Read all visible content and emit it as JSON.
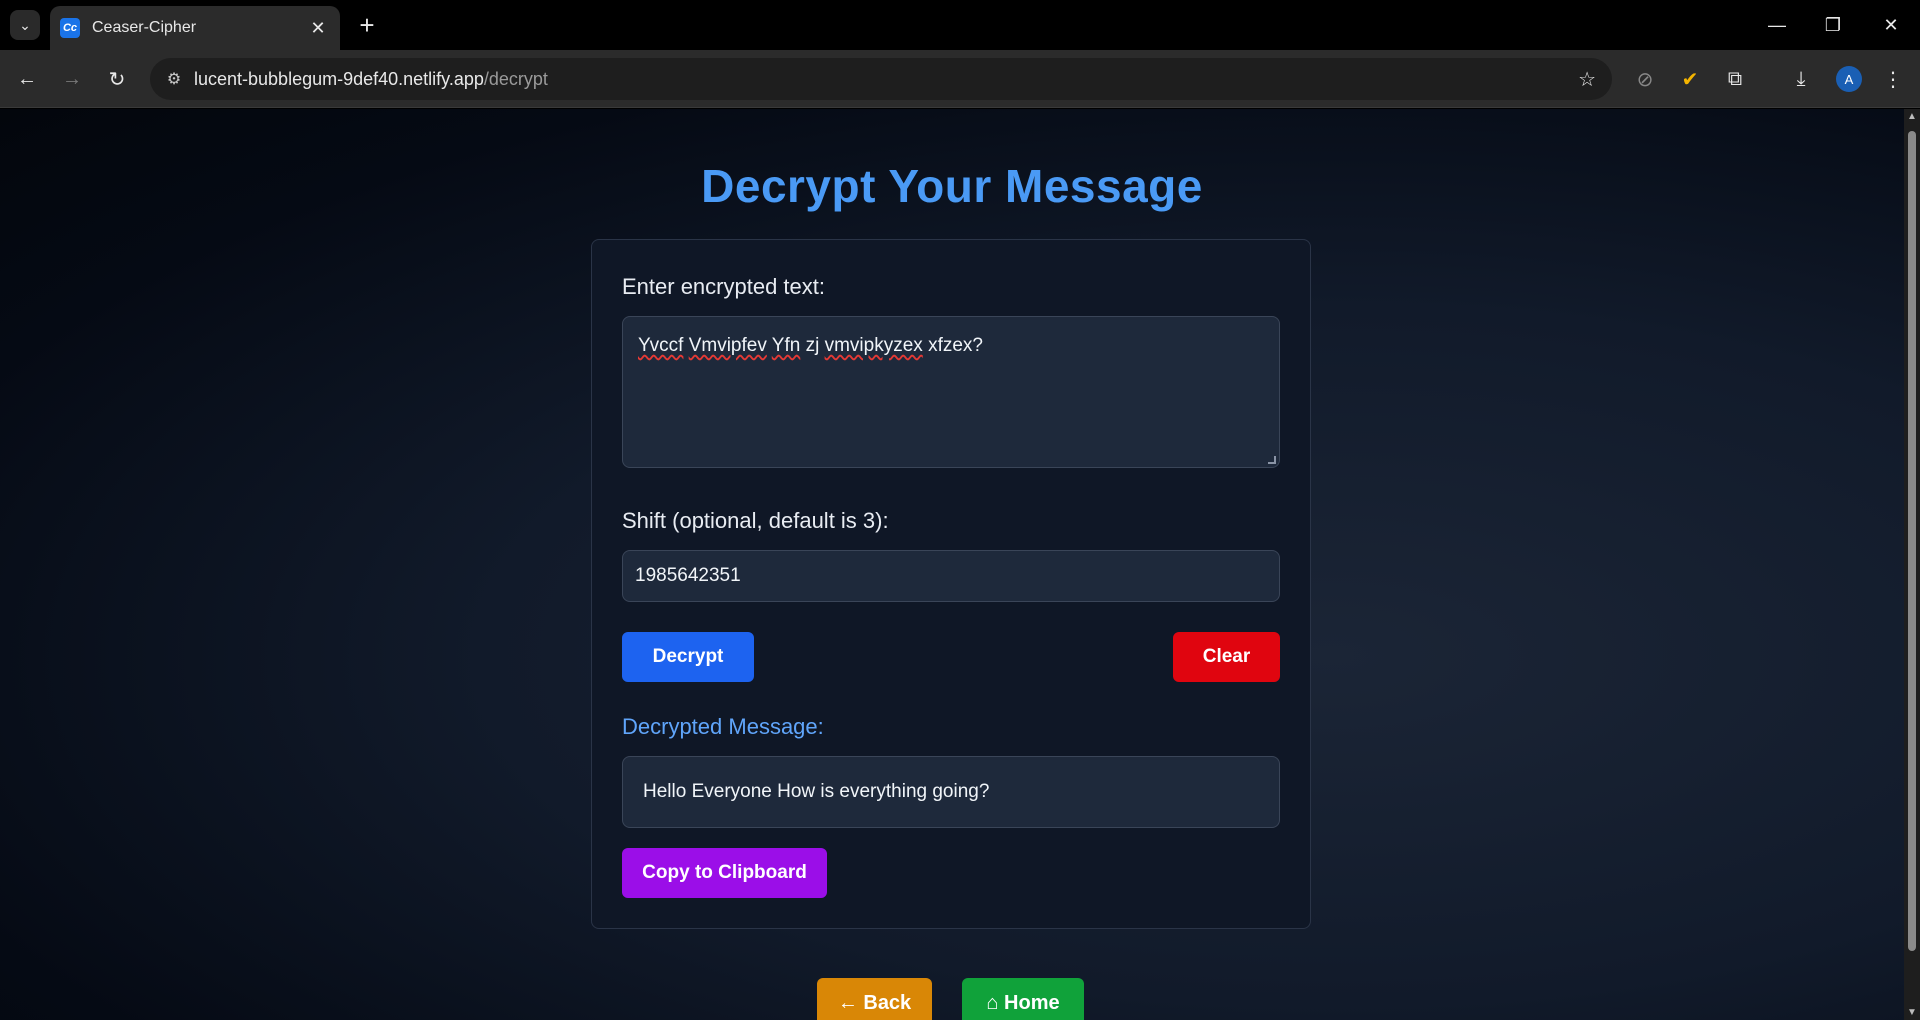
{
  "browser": {
    "tab_title": "Ceaser-Cipher",
    "favicon_text": "Cc",
    "url_host": "lucent-bubblegum-9def40.netlify.app",
    "url_path": "/decrypt",
    "profile_initial": "A"
  },
  "page": {
    "title": "Decrypt Your Message",
    "input_label": "Enter encrypted text:",
    "encrypted_words": [
      "Yvccf",
      "Vmvipfev",
      "Yfn",
      "zj",
      "vmvipkyzex",
      "xfzex?"
    ],
    "shift_label": "Shift (optional, default is 3):",
    "shift_value": "1985642351",
    "decrypt_button": "Decrypt",
    "clear_button": "Clear",
    "output_label": "Decrypted Message:",
    "output_text": "Hello Everyone How is everything going?",
    "copy_button": "Copy to Clipboard",
    "back_button": "← Back",
    "home_button": "⌂ Home"
  },
  "colors": {
    "title": "#4a9af5",
    "decrypt": "#1d63f0",
    "clear": "#e0050f",
    "copy": "#9b0ee8",
    "back": "#d98706",
    "home": "#10a23a",
    "output_label": "#60a5fa"
  }
}
